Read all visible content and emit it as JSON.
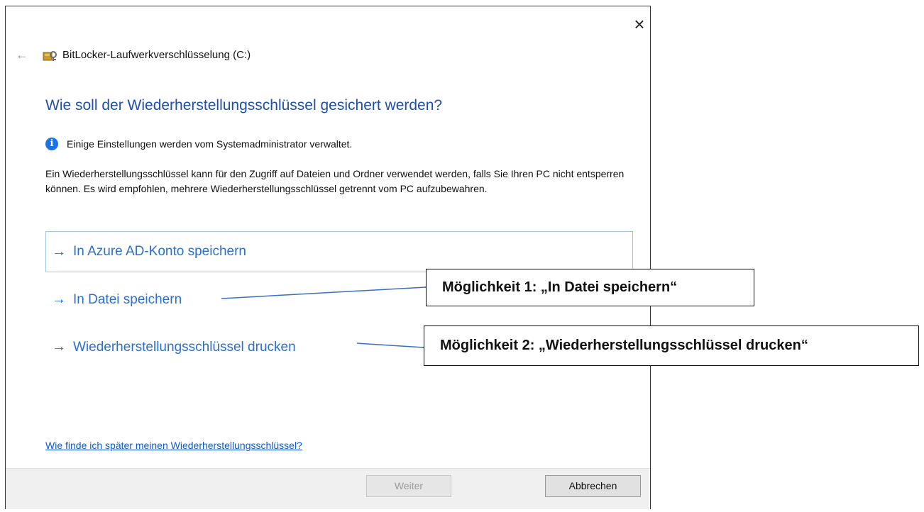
{
  "window": {
    "close_icon": "close-icon",
    "back_icon": "back-arrow-icon",
    "app_icon": "bitlocker-key-icon",
    "title": "BitLocker-Laufwerkverschlüsselung (C:)"
  },
  "main": {
    "heading": "Wie soll der Wiederherstellungsschlüssel gesichert werden?",
    "info_icon": "info-icon",
    "info_text": "Einige Einstellungen werden vom Systemadministrator verwaltet.",
    "description": "Ein Wiederherstellungsschlüssel kann für den Zugriff auf Dateien und Ordner verwendet werden, falls Sie Ihren PC nicht entsperren können. Es wird empfohlen, mehrere Wiederherstellungsschlüssel getrennt vom PC aufzubewahren.",
    "options": [
      {
        "label": "In Azure AD-Konto speichern",
        "icon": "right-arrow-icon"
      },
      {
        "label": "In Datei speichern",
        "icon": "right-arrow-icon"
      },
      {
        "label": "Wiederherstellungsschlüssel drucken",
        "icon": "right-arrow-icon"
      }
    ],
    "help_link": "Wie finde ich später meinen Wiederherstellungsschlüssel?"
  },
  "footer": {
    "next_label": "Weiter",
    "cancel_label": "Abbrechen"
  },
  "annotations": {
    "callout_1": "Möglichkeit 1: „In Datei speichern“",
    "callout_2": "Möglichkeit 2: „Wiederherstellungsschlüssel drucken“"
  },
  "colors": {
    "heading": "#1f4fa8",
    "option_link": "#2b6fd0",
    "info_icon": "#1a73e8",
    "annotation_arrow": "#3a6fc4"
  }
}
